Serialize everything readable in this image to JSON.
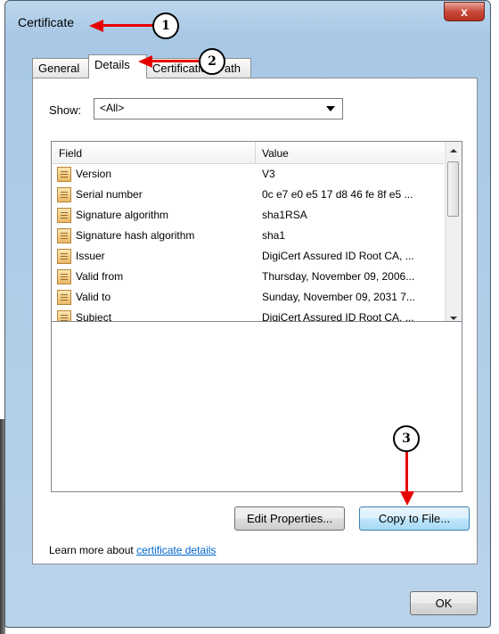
{
  "window": {
    "title": "Certificate",
    "close_label": "x"
  },
  "tabs": [
    {
      "label": "General",
      "active": false
    },
    {
      "label": "Details",
      "active": true
    },
    {
      "label": "Certification Path",
      "active": false
    }
  ],
  "show": {
    "label": "Show:",
    "selected": "<All>"
  },
  "list": {
    "columns": [
      "Field",
      "Value"
    ],
    "rows": [
      {
        "field": "Version",
        "value": "V3"
      },
      {
        "field": "Serial number",
        "value": "0c e7 e0 e5 17 d8 46 fe 8f e5 ..."
      },
      {
        "field": "Signature algorithm",
        "value": "sha1RSA"
      },
      {
        "field": "Signature hash algorithm",
        "value": "sha1"
      },
      {
        "field": "Issuer",
        "value": "DigiCert Assured ID Root CA, ..."
      },
      {
        "field": "Valid from",
        "value": "Thursday, November 09, 2006..."
      },
      {
        "field": "Valid to",
        "value": "Sunday, November 09, 2031 7..."
      },
      {
        "field": "Subject",
        "value": "DigiCert Assured ID Root CA, ..."
      }
    ]
  },
  "buttons": {
    "edit_properties": "Edit Properties...",
    "copy_to_file": "Copy to File...",
    "ok": "OK"
  },
  "learn_more": {
    "prefix": "Learn more about ",
    "link": "certificate details"
  },
  "callouts": [
    "1",
    "2",
    "3"
  ]
}
